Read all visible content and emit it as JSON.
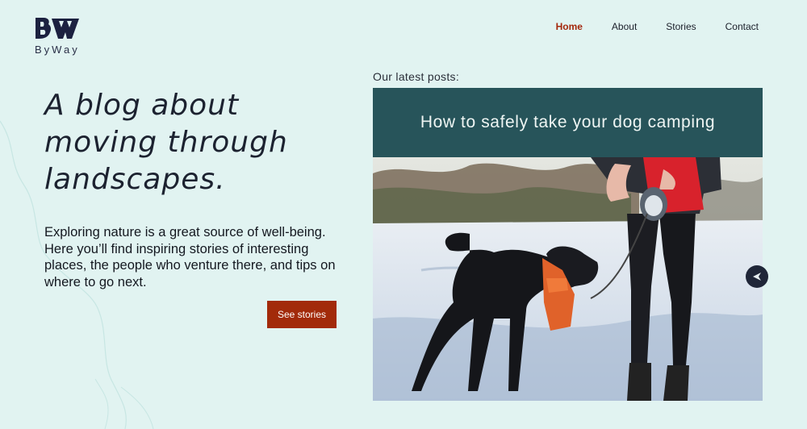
{
  "brand": {
    "monogram": "BW",
    "name": "ByWay"
  },
  "nav": {
    "items": [
      "Home",
      "About",
      "Stories",
      "Contact"
    ],
    "active": "Home"
  },
  "hero": {
    "headline": "A blog about moving through landscapes.",
    "intro": "Exploring nature is a great source of well-being. Here you’ll find inspiring stories of interesting places, the people who venture there, and tips on where to go next.",
    "cta_label": "See stories"
  },
  "posts": {
    "label": "Our latest posts:",
    "featured_title": "How to safely take your dog camping"
  },
  "icons": {
    "next": "next-arrow-icon",
    "logo": "byway-logo-icon"
  },
  "colors": {
    "background": "#e1f3f1",
    "accent": "#a22a0a",
    "card_header": "#27545a",
    "nav_active": "#a4280c"
  }
}
